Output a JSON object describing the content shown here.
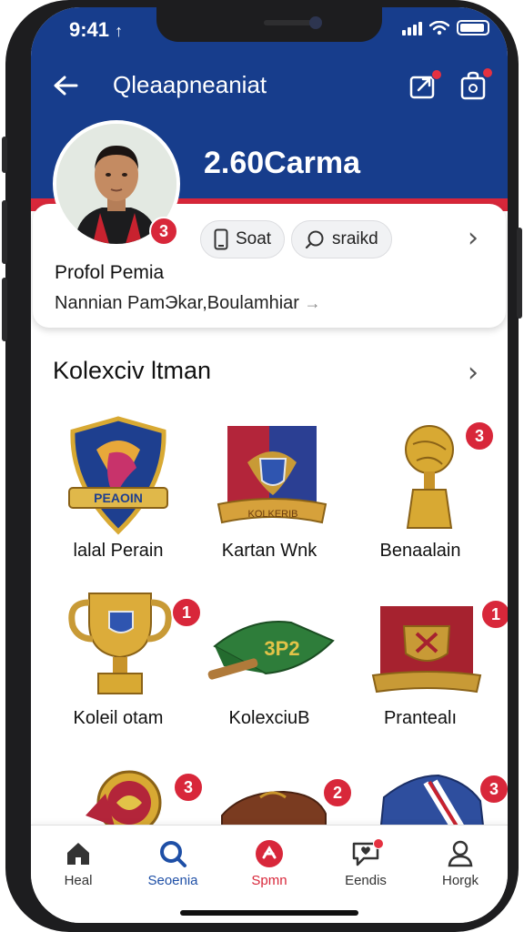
{
  "status_bar": {
    "time": "9:41",
    "time_suffix": "↑"
  },
  "header": {
    "title": "Qleaapneaniat",
    "karma": "2.60Carma",
    "avatar_badge": "3",
    "icons": [
      "back-arrow-icon",
      "share-icon",
      "bag-icon"
    ]
  },
  "profile": {
    "pill_1": "Soat",
    "pill_2": "sraikd",
    "name": "Profol Pemia",
    "subtitle": "Nannian PamЭkar,Boulamhiar"
  },
  "collection": {
    "title": "Kolexciv ltman",
    "items": [
      {
        "label": "lalal Perain",
        "badge": "",
        "icon": "crest-shield-icon",
        "crest_text": "PEAOIN"
      },
      {
        "label": "Kartan Wnk",
        "badge": "",
        "icon": "pennant-banner-icon",
        "crest_text": "KOLKERIB"
      },
      {
        "label": "Benaalain",
        "badge": "3",
        "icon": "golden-trophy-icon"
      },
      {
        "label": "Koleil otam",
        "badge": "1",
        "icon": "cup-trophy-icon"
      },
      {
        "label": "KolexciuB",
        "badge": "",
        "icon": "green-scarf-icon",
        "crest_text": "3Р2"
      },
      {
        "label": "Prantealı",
        "badge": "1",
        "icon": "red-banner-icon"
      },
      {
        "label": "",
        "badge": "3",
        "icon": "medal-icon"
      },
      {
        "label": "",
        "badge": "2",
        "icon": "brown-bag-icon"
      },
      {
        "label": "",
        "badge": "3",
        "icon": "jacket-icon"
      }
    ]
  },
  "bottom_nav": {
    "items": [
      {
        "label": "Heal",
        "icon": "home-icon",
        "color": "#333333"
      },
      {
        "label": "Seoenia",
        "icon": "search-icon",
        "color": "#1e4fa6"
      },
      {
        "label": "Spmn",
        "icon": "star-icon",
        "color": "#d8273a"
      },
      {
        "label": "Eendis",
        "icon": "chat-heart-icon",
        "color": "#333333"
      },
      {
        "label": "Horgk",
        "icon": "profile-icon",
        "color": "#333333"
      }
    ]
  },
  "colors": {
    "header_blue": "#173d8c",
    "accent_red": "#d8273a",
    "nav_blue": "#1e4fa6"
  }
}
